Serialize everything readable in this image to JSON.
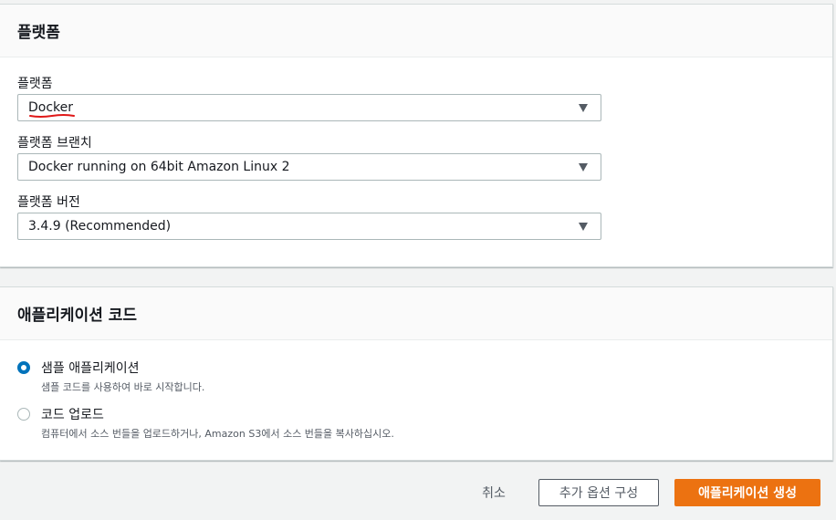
{
  "platform_section": {
    "title": "플랫폼",
    "platform": {
      "label": "플랫폼",
      "value": "Docker"
    },
    "branch": {
      "label": "플랫폼 브랜치",
      "value": "Docker running on 64bit Amazon Linux 2"
    },
    "version": {
      "label": "플랫폼 버전",
      "value": "3.4.9 (Recommended)"
    }
  },
  "app_code_section": {
    "title": "애플리케이션 코드",
    "options": [
      {
        "title": "샘플 애플리케이션",
        "desc": "샘플 코드를 사용하여 바로 시작합니다.",
        "checked": true
      },
      {
        "title": "코드 업로드",
        "desc": "컴퓨터에서 소스 번들을 업로드하거나, Amazon S3에서 소스 번들을 복사하십시오.",
        "checked": false
      }
    ]
  },
  "actions": {
    "cancel": "취소",
    "configure_more": "추가 옵션 구성",
    "create": "애플리케이션 생성"
  },
  "colors": {
    "accent": "#0073bb",
    "primary_button": "#ec7211",
    "annotation_underline": "#e01818"
  }
}
